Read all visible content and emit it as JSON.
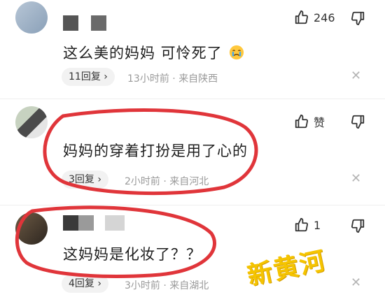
{
  "comments": [
    {
      "text": "这么美的妈妈 可怜死了",
      "emoji": "crying-face-emoji",
      "reply_count": "11回复",
      "time": "13小时前",
      "location": "来自陕西",
      "likes": "246"
    },
    {
      "text": "妈妈的穿着打扮是用了心的",
      "reply_count": "3回复",
      "time": "2小时前",
      "location": "来自河北",
      "likes": "赞"
    },
    {
      "text": "这妈妈是化妆了？？",
      "reply_count": "4回复",
      "time": "3小时前",
      "location": "来自湖北",
      "likes": "1"
    }
  ],
  "watermark": "新黄河",
  "meta_separator": "·",
  "colors": {
    "highlight_ring": "#e0353a",
    "watermark": "#f5c400",
    "meta_text": "#9a9a9a"
  }
}
